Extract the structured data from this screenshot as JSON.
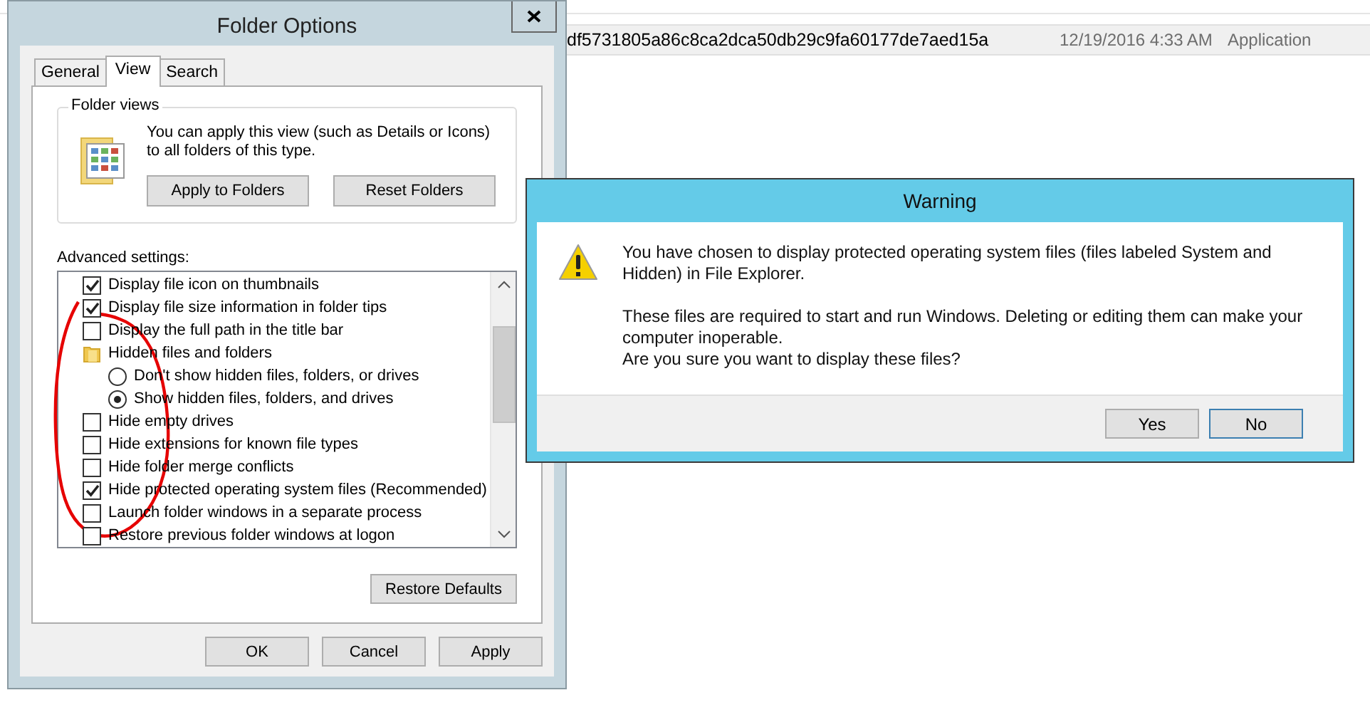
{
  "explorer": {
    "file_row": {
      "name": "df5731805a86c8ca2dca50db29c9fa60177de7aed15a",
      "date_modified": "12/19/2016 4:33 AM",
      "type": "Application"
    }
  },
  "folder_options": {
    "title": "Folder Options",
    "tabs": [
      {
        "label": "General",
        "selected": false
      },
      {
        "label": "View",
        "selected": true
      },
      {
        "label": "Search",
        "selected": false
      }
    ],
    "folder_views": {
      "legend": "Folder views",
      "description": "You can apply this view (such as Details or Icons) to all folders of this type.",
      "buttons": [
        "Apply to Folders",
        "Reset Folders"
      ]
    },
    "advanced_label": "Advanced settings:",
    "settings": [
      {
        "kind": "checkbox",
        "label": "Display file icon on thumbnails",
        "checked": true
      },
      {
        "kind": "checkbox",
        "label": "Display file size information in folder tips",
        "checked": true
      },
      {
        "kind": "checkbox",
        "label": "Display the full path in the title bar",
        "checked": false
      },
      {
        "kind": "folder",
        "label": "Hidden files and folders",
        "children": [
          {
            "kind": "radio",
            "label": "Don't show hidden files, folders, or drives",
            "selected": false
          },
          {
            "kind": "radio",
            "label": "Show hidden files, folders, and drives",
            "selected": true
          }
        ]
      },
      {
        "kind": "checkbox",
        "label": "Hide empty drives",
        "checked": false
      },
      {
        "kind": "checkbox",
        "label": "Hide extensions for known file types",
        "checked": false
      },
      {
        "kind": "checkbox",
        "label": "Hide folder merge conflicts",
        "checked": false
      },
      {
        "kind": "checkbox",
        "label": "Hide protected operating system files (Recommended)",
        "checked": true
      },
      {
        "kind": "checkbox",
        "label": "Launch folder windows in a separate process",
        "checked": false
      },
      {
        "kind": "checkbox",
        "label": "Restore previous folder windows at logon",
        "checked": false
      }
    ],
    "restore_button": "Restore Defaults",
    "buttons": [
      "OK",
      "Cancel",
      "Apply"
    ]
  },
  "warning": {
    "title": "Warning",
    "paragraphs": [
      "You have chosen to display protected operating system files (files labeled System and Hidden) in File Explorer.",
      "These files are required to start and run Windows. Deleting or editing them can make your computer inoperable.",
      "Are you sure you want to display these files?"
    ],
    "buttons": [
      {
        "label": "Yes",
        "focused": false
      },
      {
        "label": "No",
        "focused": true
      }
    ]
  }
}
